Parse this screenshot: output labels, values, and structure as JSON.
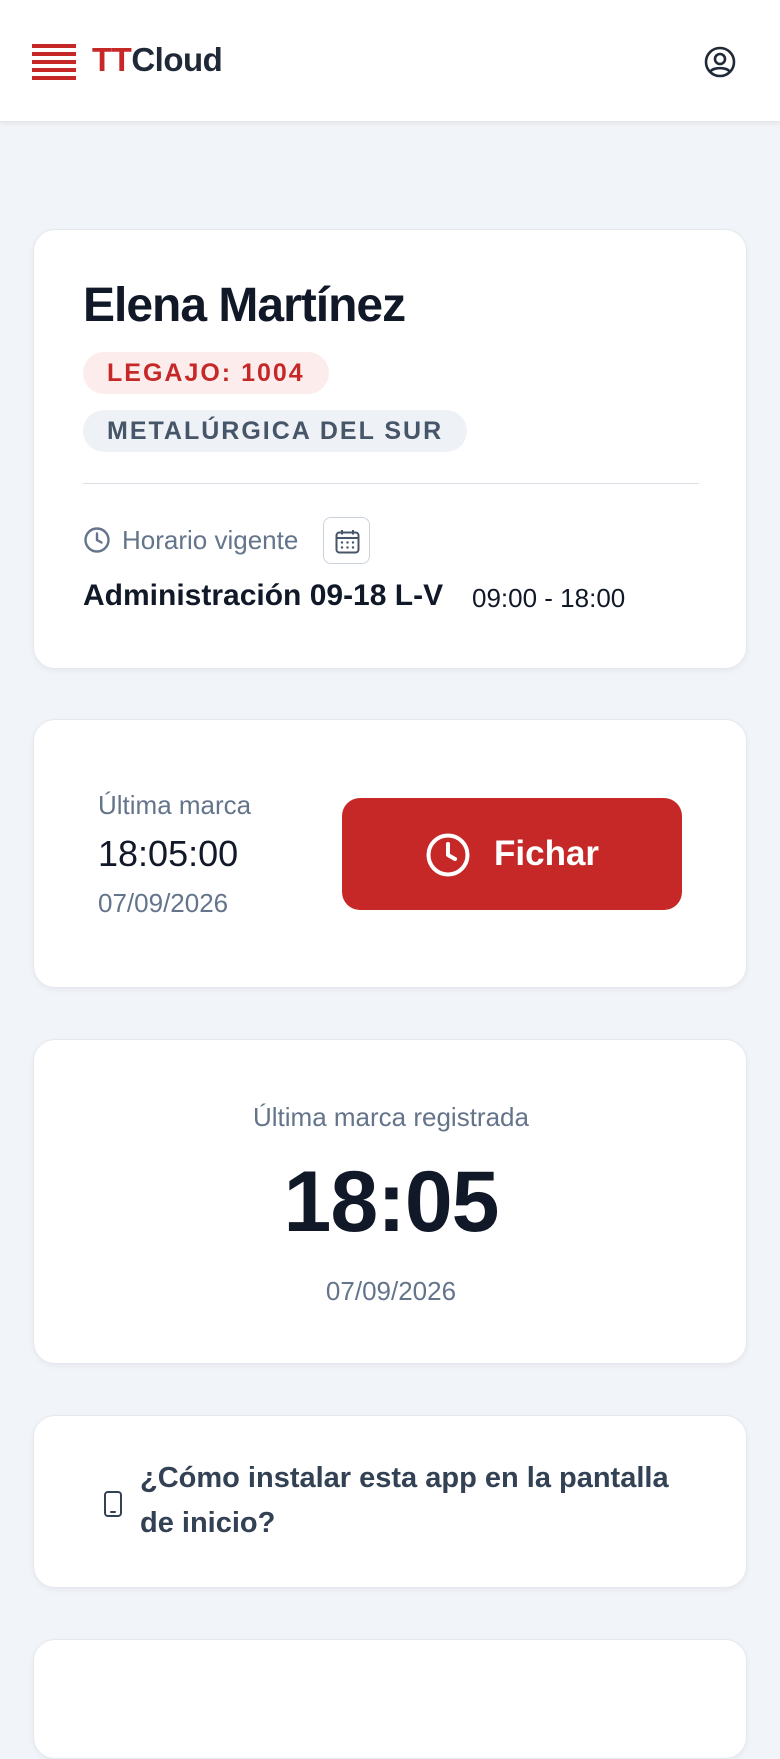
{
  "brand": {
    "part1": "TT",
    "part2": "Cloud",
    "accent_color": "#c62828"
  },
  "header": {
    "logo_icon": "brick-logo-icon",
    "profile_icon": "user-circle-icon"
  },
  "employee": {
    "name": "Elena Martínez",
    "legajo_badge": "LEGAJO: 1004",
    "company_badge": "METALÚRGICA DEL SUR"
  },
  "schedule": {
    "label": "Horario vigente",
    "icon": "clock-icon",
    "calendar_icon": "calendar-icon",
    "name": "Administración 09-18 L-V",
    "time_range": "09:00 - 18:00"
  },
  "last_mark": {
    "label": "Última marca",
    "time": "18:05:00",
    "date": "07/09/2026"
  },
  "clock_button": {
    "label": "Fichar",
    "icon": "clock-icon"
  },
  "registered": {
    "label": "Última marca registrada",
    "time": "18:05",
    "date": "07/09/2026"
  },
  "install": {
    "icon": "smartphone-icon",
    "text": "¿Cómo instalar esta app en la pantalla de inicio?"
  }
}
